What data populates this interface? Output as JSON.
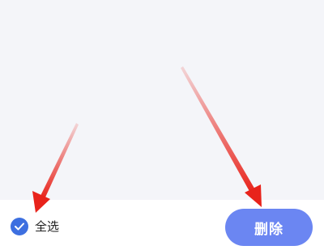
{
  "bottom_bar": {
    "select_all_label": "全选",
    "delete_label": "删除"
  },
  "colors": {
    "accent": "#3d6fe0",
    "delete_button": "#6b86f2",
    "background": "#f4f5f9",
    "annotation_arrow": "#e8231b"
  },
  "icons": {
    "select_all": "checkmark-circle-icon"
  },
  "annotations": {
    "arrow_count": 2
  }
}
